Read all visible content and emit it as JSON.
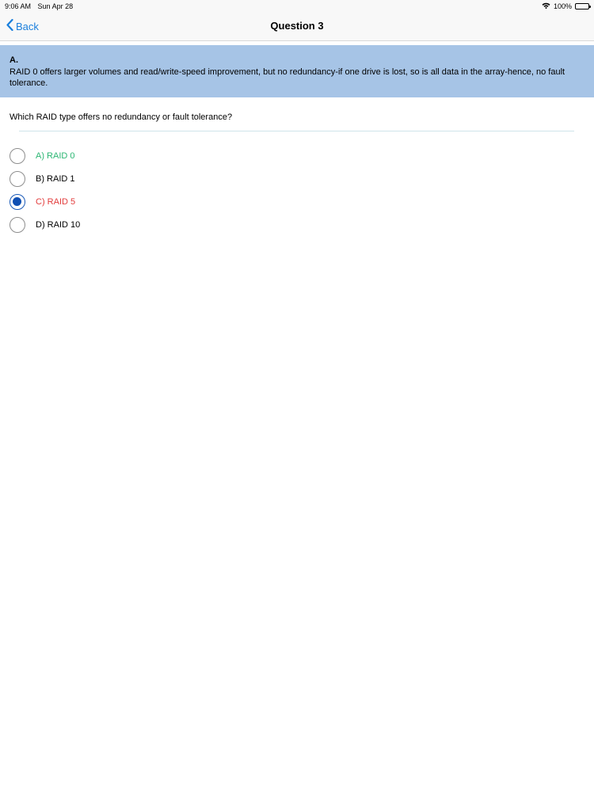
{
  "status_bar": {
    "time": "9:06 AM",
    "date": "Sun Apr 28",
    "battery": "100%"
  },
  "nav": {
    "back_label": "Back",
    "title": "Question 3"
  },
  "explanation": {
    "answer": "A.",
    "text": "RAID 0 offers larger volumes and read/write-speed improvement, but no redundancy-if one drive is lost, so is all data in the array-hence, no fault tolerance."
  },
  "question": "Which RAID type offers no redundancy or fault tolerance?",
  "options": [
    {
      "label": "A) RAID 0",
      "color": "#2bb673",
      "selected": false
    },
    {
      "label": "B) RAID 1",
      "color": "#000000",
      "selected": false
    },
    {
      "label": "C) RAID 5",
      "color": "#e23b3b",
      "selected": true
    },
    {
      "label": "D) RAID 10",
      "color": "#000000",
      "selected": false
    }
  ]
}
